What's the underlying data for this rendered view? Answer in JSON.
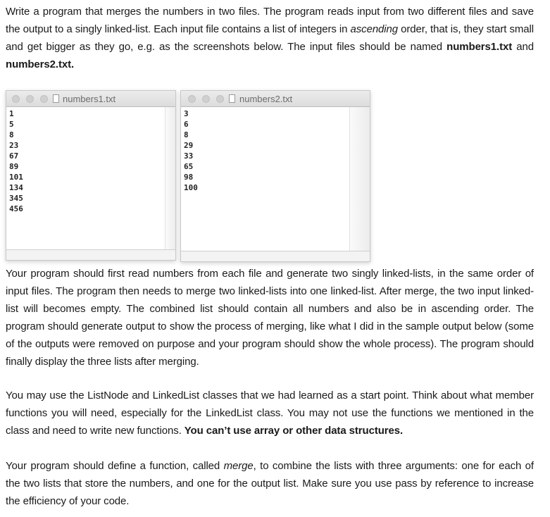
{
  "paragraph1": {
    "t1": "Write a program that merges the numbers in two files.  The program reads input from two different files and save the output to a singly linked-list.  Each input file contains a list of integers in ",
    "t1_italic": "ascending",
    "t2": " order, that is, they start small and get bigger as they go, e.g. as the screenshots below.   The input files should be named ",
    "file1_bold": "numbers1.txt",
    "t3": " and ",
    "file2_bold": "numbers2.txt."
  },
  "windows": [
    {
      "title": "numbers1.txt",
      "lines": [
        "1",
        "5",
        "8",
        "23",
        "67",
        "89",
        "101",
        "134",
        "345",
        "456"
      ]
    },
    {
      "title": "numbers2.txt",
      "lines": [
        "3",
        "6",
        "8",
        "29",
        "33",
        "65",
        "98",
        "100"
      ]
    }
  ],
  "paragraph2": {
    "text": "Your program should first read numbers from each file and generate two singly linked-lists, in the same order of input files.  The program then needs to merge two linked-lists into one linked-list.  After merge, the two input linked-list will becomes empty.  The combined list should contain all numbers and also be in ascending order.  The program should generate output to show the process of merging, like what I did in the sample output below (some of the outputs were removed on purpose and your program should show the whole process).  The program should finally display the three lists after merging."
  },
  "paragraph3": {
    "text": "You may use the ListNode and LinkedList classes that we had learned as a start point.  Think about what member functions you will need, especially for the LinkedList class.  You may not use the functions we mentioned in the class and need to write new functions.   ",
    "bold": "You can’t use array or other data structures."
  },
  "paragraph4": {
    "t1": "Your program should define a function, called ",
    "italic": "merge",
    "t2": ", to combine the lists with three arguments:  one for each of the two lists that store the numbers, and one for the output list.  Make sure you use pass by reference to increase the efficiency of your code."
  }
}
